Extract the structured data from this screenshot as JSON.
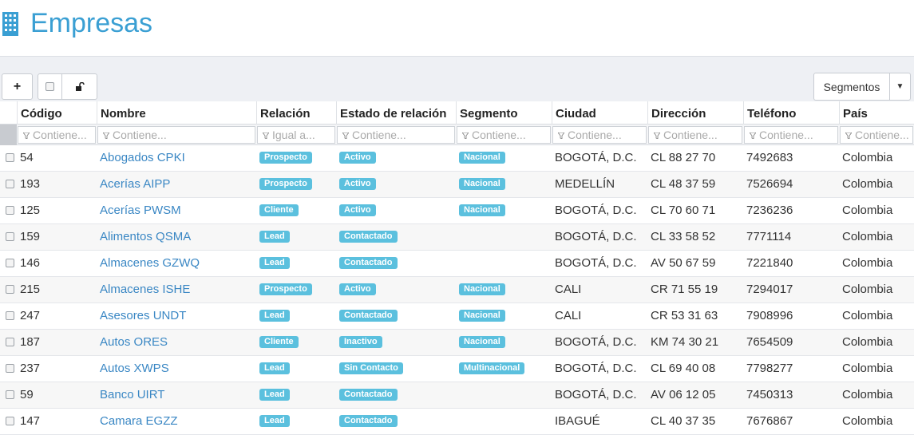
{
  "page": {
    "title": "Empresas",
    "icon": "building-icon"
  },
  "toolbar": {
    "add_label": "+",
    "segment_label": "Segmentos"
  },
  "columns": [
    {
      "key": "codigo",
      "label": "Código",
      "filter": "Contiene..."
    },
    {
      "key": "nombre",
      "label": "Nombre",
      "filter": "Contiene..."
    },
    {
      "key": "relacion",
      "label": "Relación",
      "filter": "Igual a..."
    },
    {
      "key": "estado",
      "label": "Estado de relación",
      "filter": "Contiene..."
    },
    {
      "key": "segmento",
      "label": "Segmento",
      "filter": "Contiene..."
    },
    {
      "key": "ciudad",
      "label": "Ciudad",
      "filter": "Contiene..."
    },
    {
      "key": "direccion",
      "label": "Dirección",
      "filter": "Contiene..."
    },
    {
      "key": "telefono",
      "label": "Teléfono",
      "filter": "Contiene..."
    },
    {
      "key": "pais",
      "label": "País",
      "filter": "Contiene..."
    }
  ],
  "rows": [
    {
      "codigo": "54",
      "nombre": "Abogados CPKI",
      "relacion": "Prospecto",
      "estado": "Activo",
      "segmento": "Nacional",
      "ciudad": "BOGOTÁ, D.C.",
      "direccion": "CL 88 27 70",
      "telefono": "7492683",
      "pais": "Colombia"
    },
    {
      "codigo": "193",
      "nombre": "Acerías AIPP",
      "relacion": "Prospecto",
      "estado": "Activo",
      "segmento": "Nacional",
      "ciudad": "MEDELLÍN",
      "direccion": "CL 48 37 59",
      "telefono": "7526694",
      "pais": "Colombia"
    },
    {
      "codigo": "125",
      "nombre": "Acerías PWSM",
      "relacion": "Cliente",
      "estado": "Activo",
      "segmento": "Nacional",
      "ciudad": "BOGOTÁ, D.C.",
      "direccion": "CL 70 60 71",
      "telefono": "7236236",
      "pais": "Colombia"
    },
    {
      "codigo": "159",
      "nombre": "Alimentos QSMA",
      "relacion": "Lead",
      "estado": "Contactado",
      "segmento": "",
      "ciudad": "BOGOTÁ, D.C.",
      "direccion": "CL 33 58 52",
      "telefono": "7771114",
      "pais": "Colombia"
    },
    {
      "codigo": "146",
      "nombre": "Almacenes GZWQ",
      "relacion": "Lead",
      "estado": "Contactado",
      "segmento": "",
      "ciudad": "BOGOTÁ, D.C.",
      "direccion": "AV 50 67 59",
      "telefono": "7221840",
      "pais": "Colombia"
    },
    {
      "codigo": "215",
      "nombre": "Almacenes ISHE",
      "relacion": "Prospecto",
      "estado": "Activo",
      "segmento": "Nacional",
      "ciudad": "CALI",
      "direccion": "CR 71 55 19",
      "telefono": "7294017",
      "pais": "Colombia"
    },
    {
      "codigo": "247",
      "nombre": "Asesores UNDT",
      "relacion": "Lead",
      "estado": "Contactado",
      "segmento": "Nacional",
      "ciudad": "CALI",
      "direccion": "CR 53 31 63",
      "telefono": "7908996",
      "pais": "Colombia"
    },
    {
      "codigo": "187",
      "nombre": "Autos ORES",
      "relacion": "Cliente",
      "estado": "Inactivo",
      "segmento": "Nacional",
      "ciudad": "BOGOTÁ, D.C.",
      "direccion": "KM 74 30 21",
      "telefono": "7654509",
      "pais": "Colombia"
    },
    {
      "codigo": "237",
      "nombre": "Autos XWPS",
      "relacion": "Lead",
      "estado": "Sin Contacto",
      "segmento": "Multinacional",
      "ciudad": "BOGOTÁ, D.C.",
      "direccion": "CL 69 40 08",
      "telefono": "7798277",
      "pais": "Colombia"
    },
    {
      "codigo": "59",
      "nombre": "Banco UIRT",
      "relacion": "Lead",
      "estado": "Contactado",
      "segmento": "",
      "ciudad": "BOGOTÁ, D.C.",
      "direccion": "AV 06 12 05",
      "telefono": "7450313",
      "pais": "Colombia"
    },
    {
      "codigo": "147",
      "nombre": "Camara EGZZ",
      "relacion": "Lead",
      "estado": "Contactado",
      "segmento": "",
      "ciudad": "IBAGUÉ",
      "direccion": "CL 40 37 35",
      "telefono": "7676867",
      "pais": "Colombia"
    }
  ],
  "colors": {
    "accent": "#3a9fd3",
    "badge": "#5bc0de",
    "link": "#3a87c4"
  }
}
